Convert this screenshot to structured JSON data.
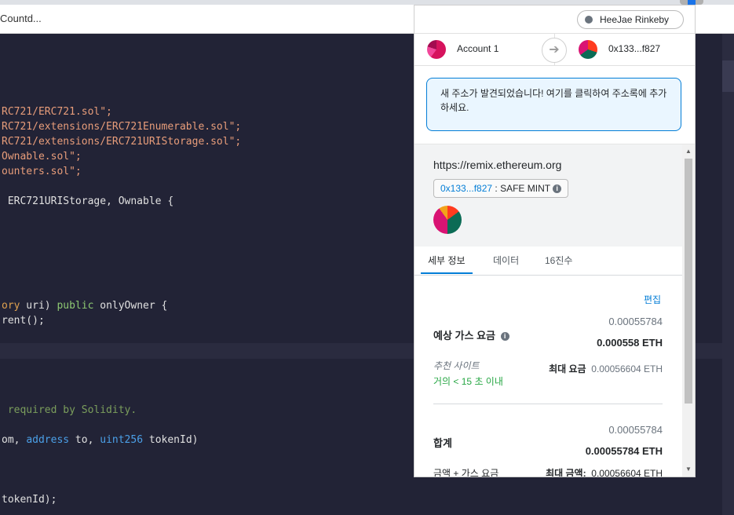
{
  "browser": {
    "tab_title": "Countd..."
  },
  "editor": {
    "lines": [
      {
        "pre": "",
        "str": "RC721/ERC721.sol\";",
        "post": ""
      },
      {
        "pre": "",
        "str": "RC721/extensions/ERC721Enumerable.sol\";",
        "post": ""
      },
      {
        "pre": "",
        "str": "RC721/extensions/ERC721URIStorage.sol\";",
        "post": ""
      },
      {
        "pre": "",
        "str": "Ownable.sol\";",
        "post": ""
      },
      {
        "pre": "",
        "str": "ounters.sol\";",
        "post": ""
      },
      {
        "text": " ERC721URIStorage, Ownable {"
      },
      {
        "orange": "ory",
        "mid1": " uri) ",
        "green": "public",
        "mid2": " onlyOwner {"
      },
      {
        "text": "rent();"
      },
      {
        "comment": " required by Solidity."
      },
      {
        "a": "om, ",
        "b1": "address",
        "c": " to, ",
        "b2": "uint256",
        "d": " tokenId)"
      },
      {
        "text": "tokenId);"
      }
    ]
  },
  "popup": {
    "network": "HeeJae Rinkeby",
    "account_name": "Account 1",
    "to_address": "0x133...f827",
    "notice": "새 주소가 발견되었습니다! 여기를 클릭하여 주소록에 추가하세요.",
    "origin": "https://remix.ethereum.org",
    "method_address": "0x133...f827",
    "method_separator": " : ",
    "method_name": "SAFE MINT",
    "tabs": [
      "세부 정보",
      "데이터",
      "16진수"
    ],
    "details": {
      "edit_label": "편집",
      "gas_label": "예상 가스 요금",
      "gas_value": "0.00055784",
      "gas_value_eth": "0.000558 ETH",
      "site_label": "추천 사이트",
      "site_time": "거의 < 15 초 이내",
      "max_fee_label": "최대 요금",
      "max_fee_value": "0.00056604 ETH",
      "total_label": "합계",
      "total_value": "0.00055784",
      "total_value_eth": "0.00055784 ETH",
      "total_sub_label": "금액 + 가스 요금",
      "total_max_label": "최대 금액:",
      "total_max_value": "0.00056604 ETH"
    }
  },
  "colors": {
    "accent": "#037dd6",
    "success": "#28a745",
    "editor_bg": "#222336"
  }
}
